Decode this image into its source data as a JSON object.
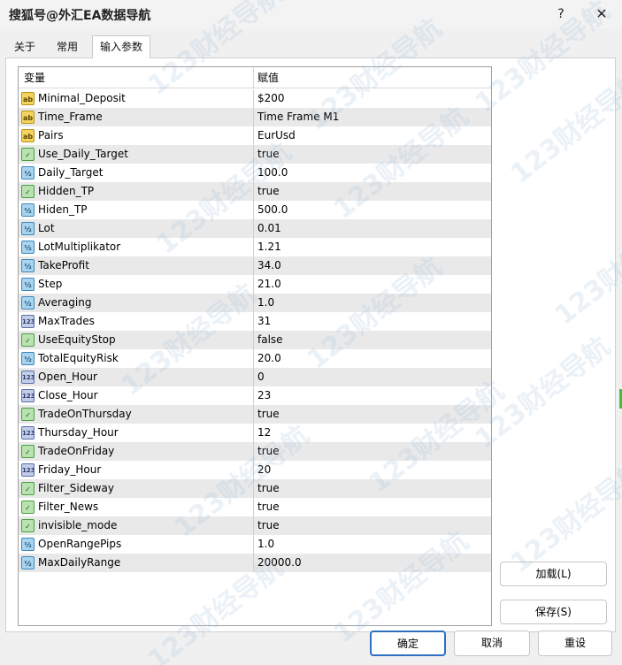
{
  "window": {
    "title": "搜狐号@外汇EA数据导航",
    "help_label": "?",
    "close_label": "✕"
  },
  "tabs": [
    {
      "label": "关于"
    },
    {
      "label": "常用"
    },
    {
      "label": "输入参数"
    }
  ],
  "grid": {
    "col_variable": "变量",
    "col_value": "赋值",
    "rows": [
      {
        "name": "Minimal_Deposit",
        "value": "$200",
        "type": "string",
        "icon": "ab"
      },
      {
        "name": "Time_Frame",
        "value": "Time Frame M1",
        "type": "string",
        "icon": "ab"
      },
      {
        "name": "Pairs",
        "value": "EurUsd",
        "type": "string",
        "icon": "ab"
      },
      {
        "name": "Use_Daily_Target",
        "value": "true",
        "type": "bool",
        "icon": "✓"
      },
      {
        "name": "Daily_Target",
        "value": "100.0",
        "type": "double",
        "icon": "½"
      },
      {
        "name": "Hidden_TP",
        "value": "true",
        "type": "bool",
        "icon": "✓"
      },
      {
        "name": "Hiden_TP",
        "value": "500.0",
        "type": "double",
        "icon": "½"
      },
      {
        "name": "Lot",
        "value": "0.01",
        "type": "double",
        "icon": "½"
      },
      {
        "name": "LotMultiplikator",
        "value": "1.21",
        "type": "double",
        "icon": "½"
      },
      {
        "name": "TakeProfit",
        "value": "34.0",
        "type": "double",
        "icon": "½"
      },
      {
        "name": "Step",
        "value": "21.0",
        "type": "double",
        "icon": "½"
      },
      {
        "name": "Averaging",
        "value": "1.0",
        "type": "double",
        "icon": "½"
      },
      {
        "name": "MaxTrades",
        "value": "31",
        "type": "int",
        "icon": "123"
      },
      {
        "name": "UseEquityStop",
        "value": "false",
        "type": "bool",
        "icon": "✓"
      },
      {
        "name": "TotalEquityRisk",
        "value": "20.0",
        "type": "double",
        "icon": "½"
      },
      {
        "name": "Open_Hour",
        "value": "0",
        "type": "int",
        "icon": "123"
      },
      {
        "name": "Close_Hour",
        "value": "23",
        "type": "int",
        "icon": "123"
      },
      {
        "name": "TradeOnThursday",
        "value": "true",
        "type": "bool",
        "icon": "✓"
      },
      {
        "name": "Thursday_Hour",
        "value": "12",
        "type": "int",
        "icon": "123"
      },
      {
        "name": "TradeOnFriday",
        "value": "true",
        "type": "bool",
        "icon": "✓"
      },
      {
        "name": "Friday_Hour",
        "value": "20",
        "type": "int",
        "icon": "123"
      },
      {
        "name": "Filter_Sideway",
        "value": "true",
        "type": "bool",
        "icon": "✓"
      },
      {
        "name": "Filter_News",
        "value": "true",
        "type": "bool",
        "icon": "✓"
      },
      {
        "name": "invisible_mode",
        "value": "true",
        "type": "bool",
        "icon": "✓"
      },
      {
        "name": "OpenRangePips",
        "value": "1.0",
        "type": "double",
        "icon": "½"
      },
      {
        "name": "MaxDailyRange",
        "value": "20000.0",
        "type": "double",
        "icon": "½"
      }
    ]
  },
  "buttons": {
    "load": "加载(L)",
    "save": "保存(S)",
    "ok": "确定",
    "cancel": "取消",
    "reset": "重设"
  },
  "watermark": "123财经导航"
}
